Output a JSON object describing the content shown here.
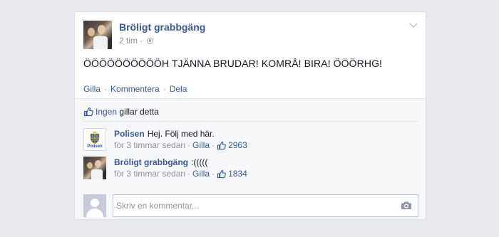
{
  "post": {
    "author": "Bröligt grabbgäng",
    "time": "2 tim",
    "text": "ÖÖÖÖÖÖÖÖÖÖH TJÄNNA BRUDAR! KOMRÅ! BIRA! ÖÖÖRHG!",
    "actions": {
      "like": "Gilla",
      "separator": "·",
      "comment": "Kommentera",
      "share": "Dela"
    }
  },
  "likes": {
    "who": "Ingen",
    "rest": "gillar detta"
  },
  "comments": [
    {
      "author": "Polisen",
      "text": "Hej. Följ med här.",
      "time": "för 3 timmar sedan",
      "like": "Gilla",
      "separator": "·",
      "like_count": "2963",
      "avatar": "police-crest-icon",
      "avatar_label": "Polisen"
    },
    {
      "author": "Bröligt grabbgäng",
      "text": ":(((((",
      "time": "för 3 timmar sedan",
      "like": "Gilla",
      "separator": "·",
      "like_count": "1834",
      "avatar": "group-photo"
    }
  ],
  "compose": {
    "placeholder": "Skriv en kommentar...",
    "value": ""
  },
  "colors": {
    "link": "#3b5998",
    "meta": "#90949c",
    "background": "#e9eaed",
    "feedback_bg": "#f6f7f9"
  }
}
